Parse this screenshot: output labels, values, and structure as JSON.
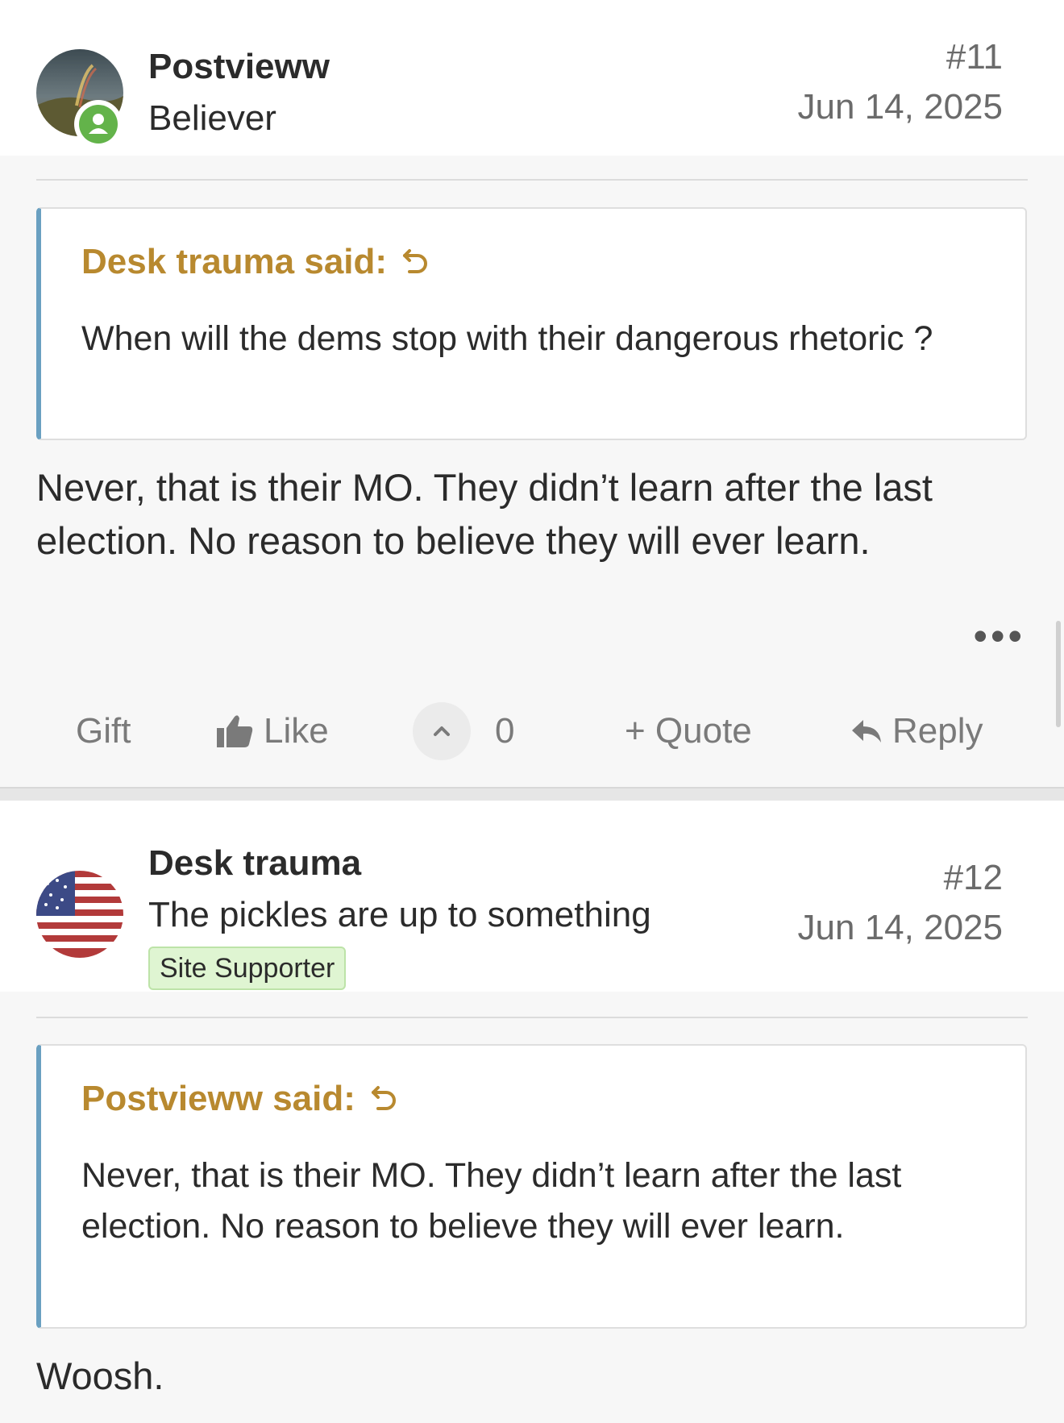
{
  "posts": [
    {
      "username": "Postvieww",
      "user_title": "Believer",
      "post_number": "#11",
      "date": "Jun 14, 2025",
      "online": true,
      "quote": {
        "author": "Desk trauma said:",
        "text": "When will the dems stop with their dangerous rhetoric ?"
      },
      "message": "Never, that is their MO. They didn’t learn after the last election. No reason to believe they will ever learn.",
      "actions": {
        "gift": "Gift",
        "like": "Like",
        "vote_count": "0",
        "quote": "+ Quote",
        "reply": "Reply"
      }
    },
    {
      "username": "Desk trauma",
      "user_title": "The pickles are up to something",
      "badge": "Site Supporter",
      "post_number": "#12",
      "date": "Jun 14, 2025",
      "quote": {
        "author": "Postvieww said:",
        "text": "Never, that is their MO. They didn’t learn after the last election. No reason to believe they will ever learn."
      },
      "message": "Woosh."
    }
  ],
  "colors": {
    "quote_author": "#b8892f",
    "quote_border": "#6aa0c1",
    "online": "#63b34a",
    "badge_bg": "#dff5d2"
  },
  "icons": [
    "online-user-icon",
    "jump-to-quote-icon",
    "thumbs-up-icon",
    "chevron-up-icon",
    "reply-arrow-icon",
    "more-options-icon"
  ]
}
